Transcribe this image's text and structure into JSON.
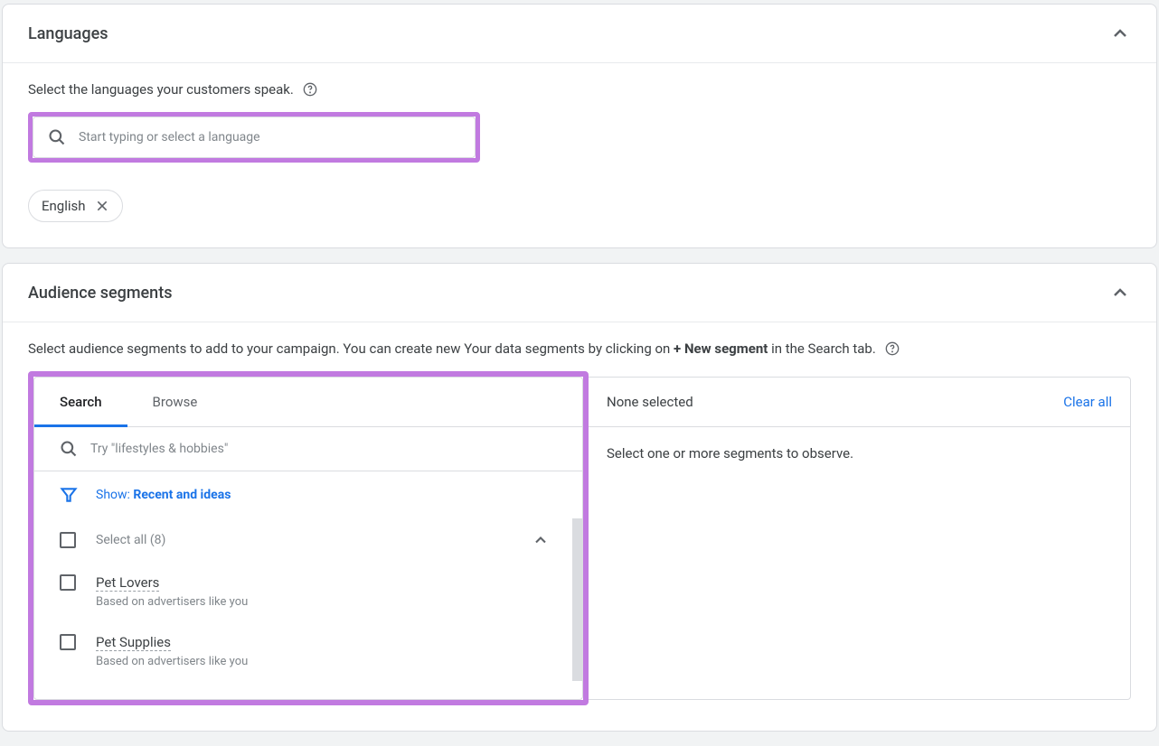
{
  "languages": {
    "title": "Languages",
    "subtitle": "Select the languages your customers speak.",
    "search_placeholder": "Start typing or select a language",
    "selected_chip": "English"
  },
  "audience": {
    "title": "Audience segments",
    "subtitle_prefix": "Select audience segments to add to your campaign. You can create new Your data segments by clicking on ",
    "subtitle_bold": "+ New segment",
    "subtitle_suffix": " in the Search tab.",
    "tabs": {
      "search": "Search",
      "browse": "Browse"
    },
    "search_placeholder": "Try \"lifestyles & hobbies\"",
    "filter_label": "Show: ",
    "filter_value": "Recent and ideas",
    "select_all": "Select all (8)",
    "segments": [
      {
        "name": "Pet Lovers",
        "desc": "Based on advertisers like you"
      },
      {
        "name": "Pet Supplies",
        "desc": "Based on advertisers like you"
      }
    ],
    "right": {
      "title": "None selected",
      "clear_all": "Clear all",
      "empty_text": "Select one or more segments to observe."
    }
  }
}
